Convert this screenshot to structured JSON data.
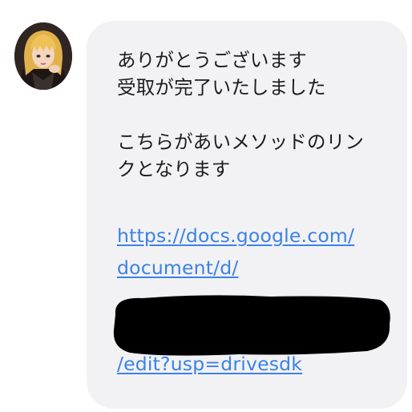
{
  "chat": {
    "avatar_icon": "user-avatar-icon",
    "message": {
      "line1": "ありがとうございます",
      "line2": "受取が完了いたしました",
      "line3": "こちらがあいメソッドのリン",
      "line4": "クとなります",
      "link_line1": "https://docs.google.com/",
      "link_line2": "document/d/",
      "link_line3": "/edit?usp=drivesdk"
    },
    "colors": {
      "bubble": "#f2f2f4",
      "link": "#3b82e6",
      "text": "#1c1c1e",
      "redaction": "#000000"
    }
  }
}
